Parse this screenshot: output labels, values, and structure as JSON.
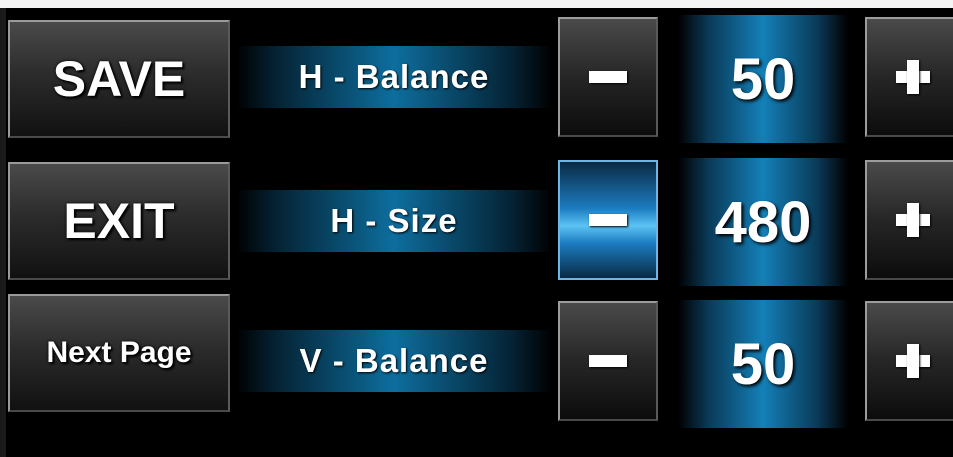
{
  "actions": {
    "save_label": "SAVE",
    "exit_label": "EXIT",
    "next_page_label": "Next Page"
  },
  "parameters": [
    {
      "label": "H - Balance",
      "value": "50",
      "minus_active": false
    },
    {
      "label": "H - Size",
      "value": "480",
      "minus_active": true
    },
    {
      "label": "V - Balance",
      "value": "50",
      "minus_active": false
    }
  ],
  "colors": {
    "accent_blue": "#1380b8",
    "active_button_blue": "#5cc3f4",
    "background": "#000000",
    "button_gray": "#2c2c2c"
  },
  "icons": {
    "minus": "minus-icon",
    "plus": "plus-icon"
  }
}
